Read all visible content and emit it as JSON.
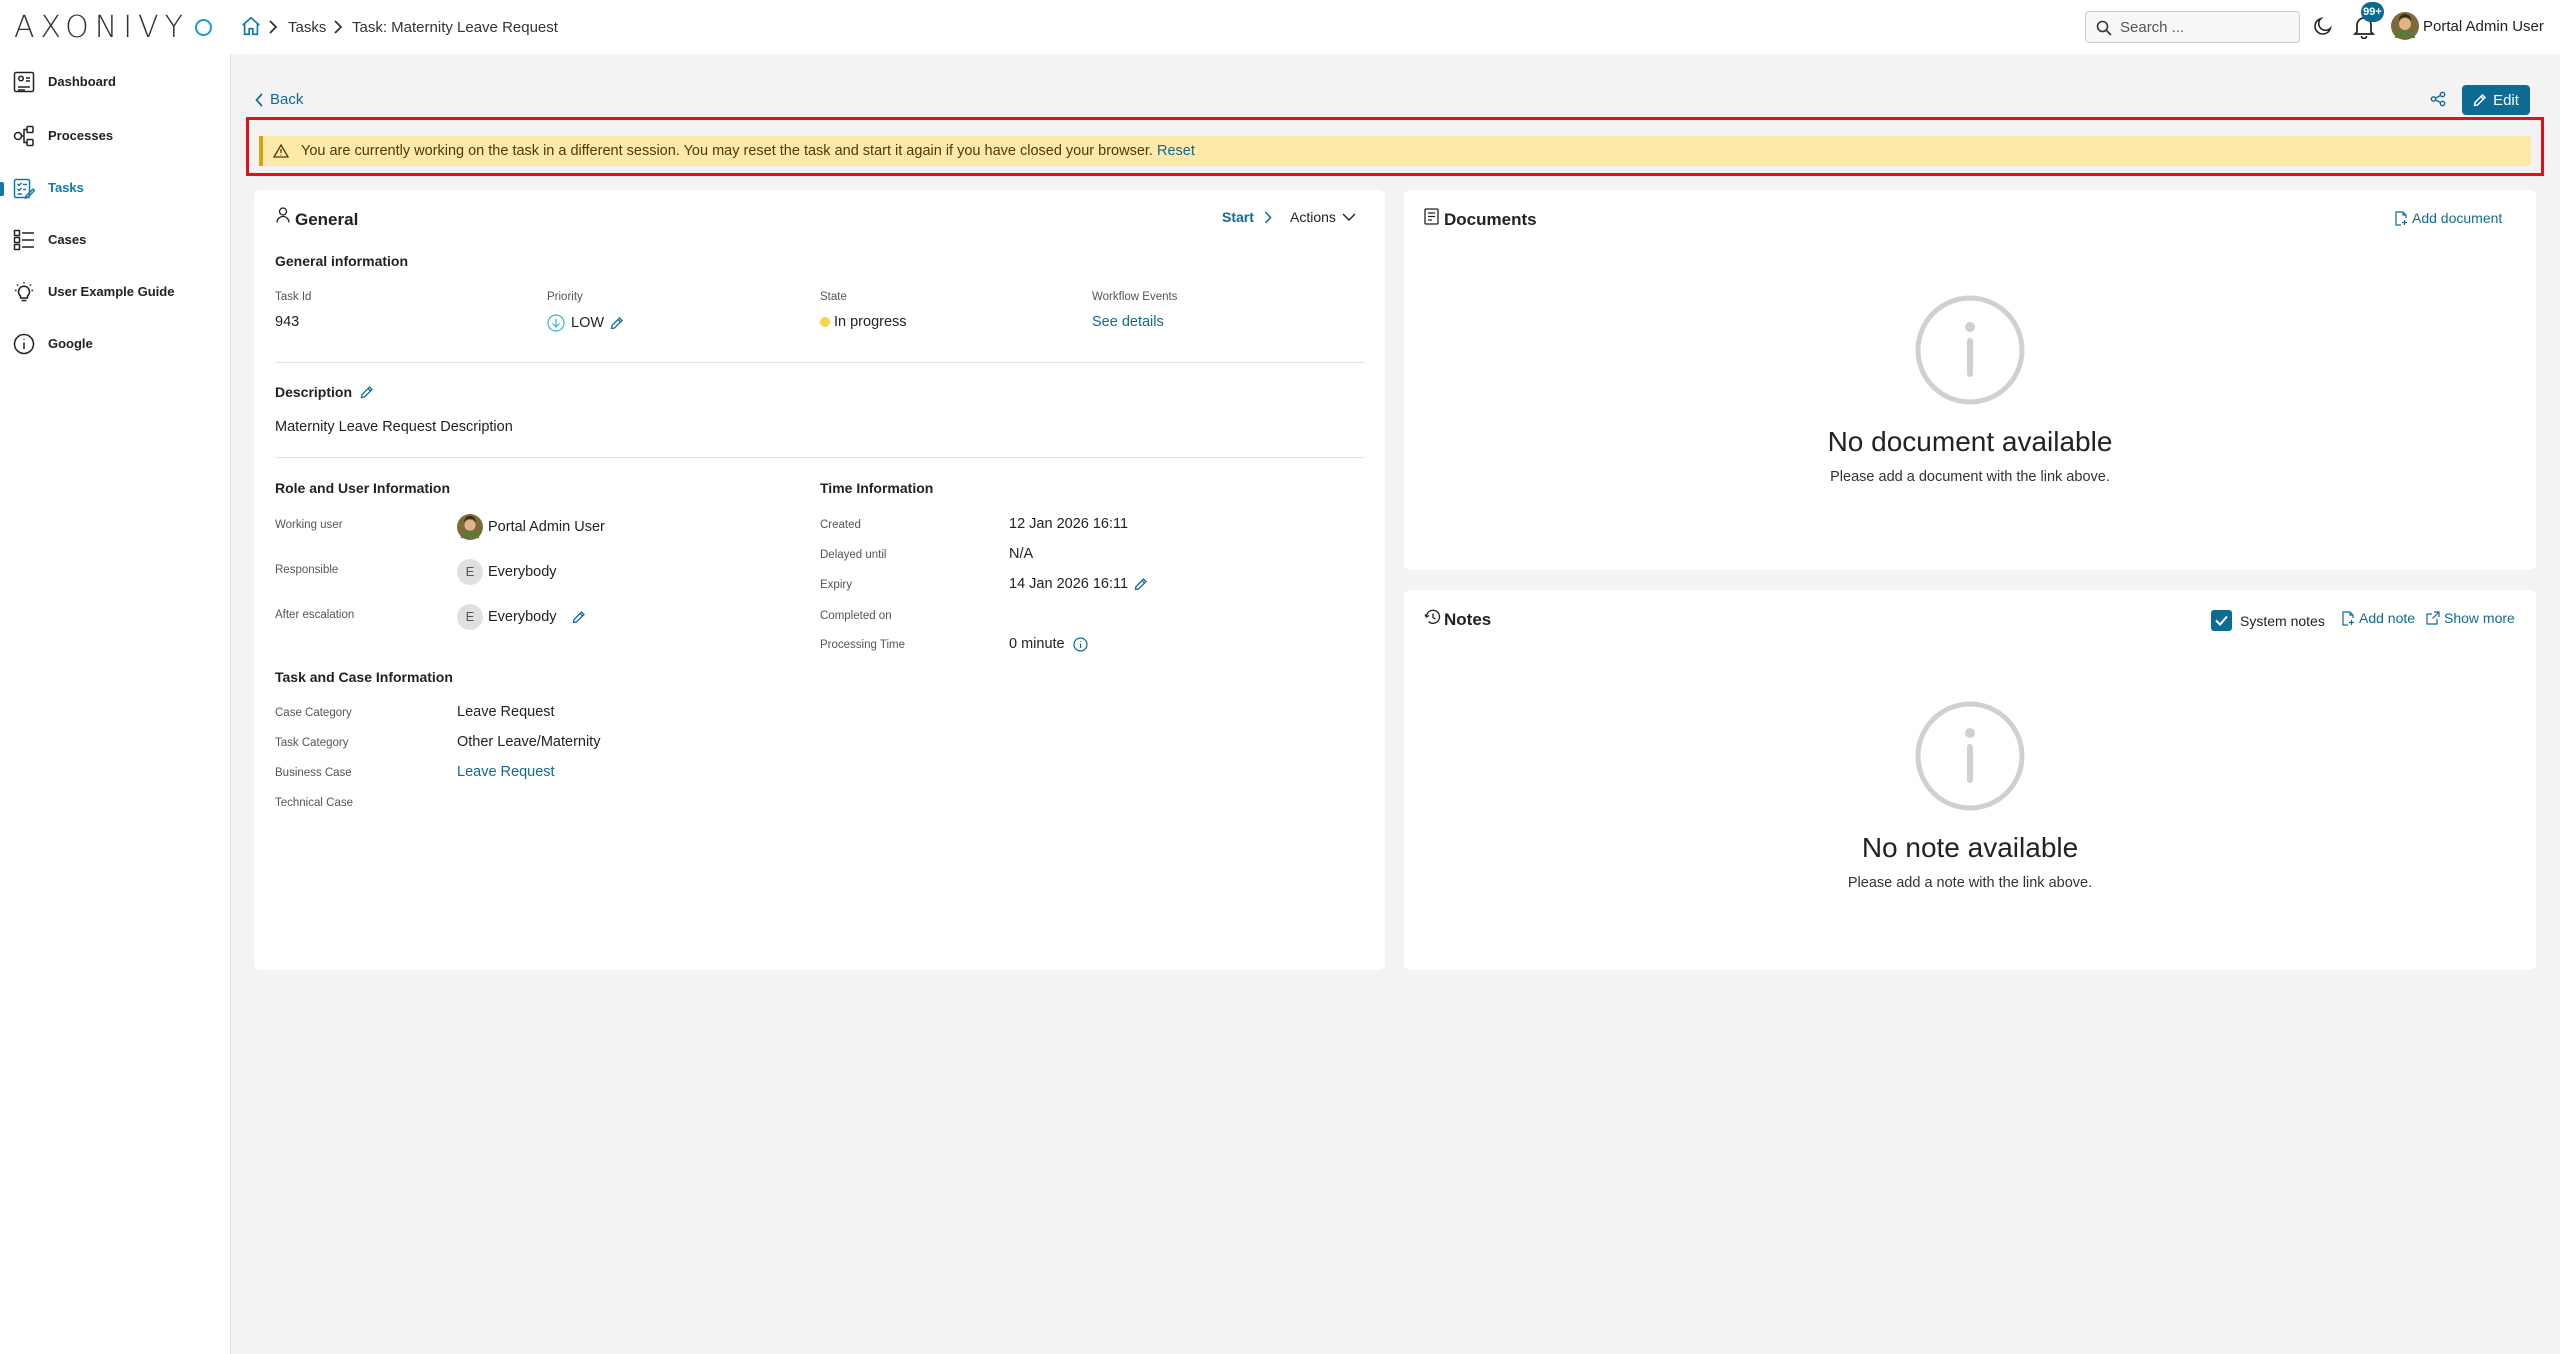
{
  "brand": {
    "logo": "AXONIVY"
  },
  "breadcrumb": {
    "items": [
      "Tasks",
      "Task: Maternity Leave Request"
    ]
  },
  "search": {
    "placeholder": "Search ..."
  },
  "notifications": {
    "badge": "99+"
  },
  "user": {
    "name": "Portal Admin User"
  },
  "sidebar": {
    "items": [
      {
        "label": "Dashboard"
      },
      {
        "label": "Processes"
      },
      {
        "label": "Tasks"
      },
      {
        "label": "Cases"
      },
      {
        "label": "User Example Guide"
      },
      {
        "label": "Google"
      }
    ]
  },
  "page": {
    "back_label": "Back",
    "edit_label": "Edit"
  },
  "warning": {
    "message": "You are currently working on the task in a different session. You may reset the task and start it again if you have closed your browser.",
    "reset_label": "Reset"
  },
  "general": {
    "title": "General",
    "start_label": "Start",
    "actions_label": "Actions",
    "info_title": "General information",
    "task_id_label": "Task Id",
    "task_id": "943",
    "priority_label": "Priority",
    "priority": "LOW",
    "state_label": "State",
    "state": "In progress",
    "workflow_label": "Workflow Events",
    "workflow_link": "See details",
    "description_title": "Description",
    "description": "Maternity Leave Request Description",
    "role_title": "Role and User Information",
    "working_user_label": "Working user",
    "working_user": "Portal Admin User",
    "responsible_label": "Responsible",
    "responsible": "Everybody",
    "escalation_label": "After escalation",
    "escalation": "Everybody",
    "avatar_initial": "E",
    "time_title": "Time Information",
    "created_label": "Created",
    "created": "12 Jan 2026 16:11",
    "delayed_label": "Delayed until",
    "delayed": "N/A",
    "expiry_label": "Expiry",
    "expiry": "14 Jan 2026 16:11",
    "completed_label": "Completed on",
    "completed": "",
    "processing_label": "Processing Time",
    "processing": "0 minute",
    "case_title": "Task and Case Information",
    "case_category_label": "Case Category",
    "case_category": "Leave Request",
    "task_category_label": "Task Category",
    "task_category": "Other Leave/Maternity",
    "business_case_label": "Business Case",
    "business_case": "Leave Request",
    "technical_case_label": "Technical Case",
    "technical_case": ""
  },
  "documents": {
    "title": "Documents",
    "add_label": "Add document",
    "empty_title": "No document available",
    "empty_sub": "Please add a document with the link above."
  },
  "notes": {
    "title": "Notes",
    "system_notes_label": "System notes",
    "system_notes_checked": true,
    "add_label": "Add note",
    "show_more_label": "Show more",
    "empty_title": "No note available",
    "empty_sub": "Please add a note with the link above."
  },
  "colors": {
    "accent": "#0e6c94",
    "warning_bg": "#fdeaaa",
    "warning_frame": "#e3101a",
    "state_dot": "#f5d54a"
  }
}
